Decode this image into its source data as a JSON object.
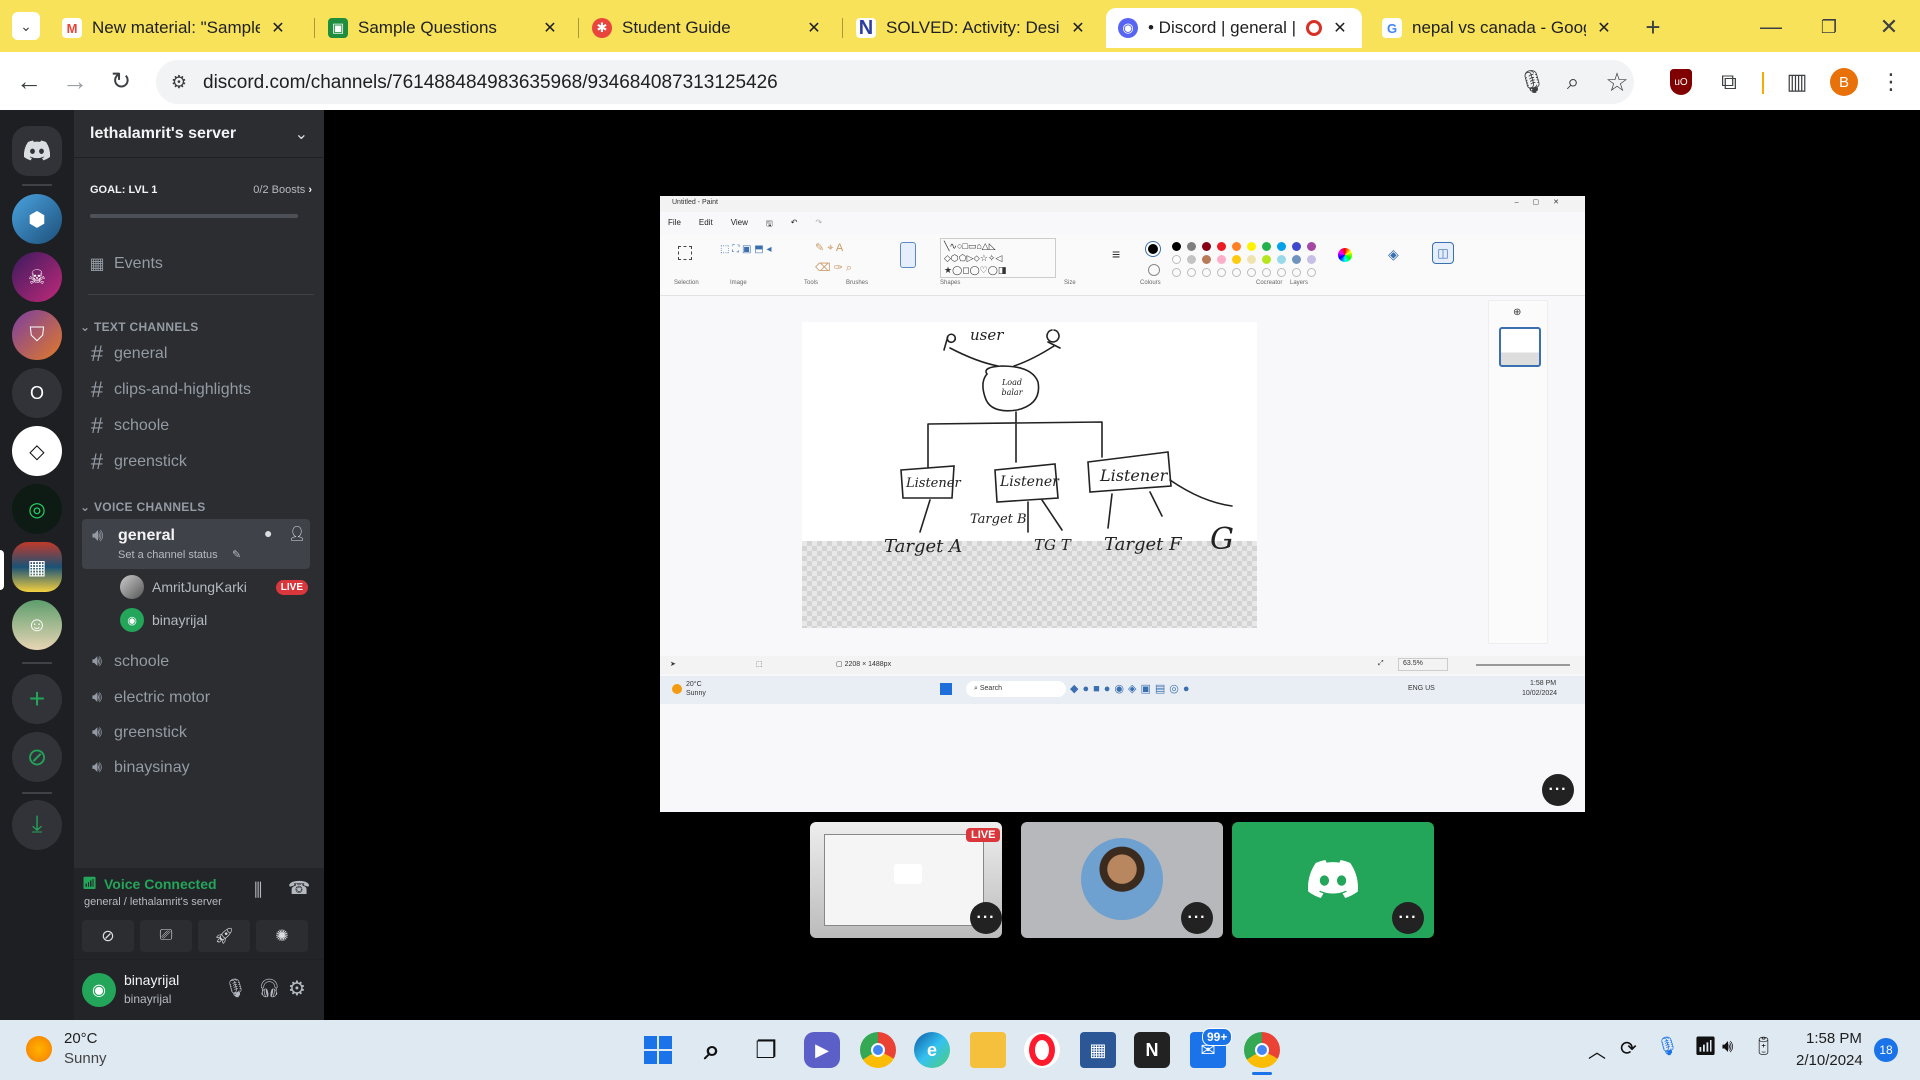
{
  "browser": {
    "tabs": [
      {
        "title": "New material: \"Sample Q",
        "icon": "gmail-icon",
        "color": "#ea4335",
        "glyph": "M"
      },
      {
        "title": "Sample Questions",
        "icon": "classroom-icon",
        "color": "#1e8e3e",
        "glyph": "▣"
      },
      {
        "title": "Student Guide",
        "icon": "guide-icon",
        "color": "#e8453c",
        "glyph": "✱"
      },
      {
        "title": "SOLVED: Activity: Design",
        "icon": "numerade-icon",
        "color": "#2c3e9f",
        "glyph": "N"
      },
      {
        "title": "• Discord | general | l",
        "icon": "discord-icon",
        "color": "#5865f2",
        "glyph": "◉",
        "active": true
      },
      {
        "title": "nepal vs canada - Google",
        "icon": "google-icon",
        "color": "#4285f4",
        "glyph": "G"
      }
    ],
    "url": "discord.com/channels/761488484983635968/934684087313125426",
    "profile_letter": "B"
  },
  "discord": {
    "server_name": "lethalamrit's server",
    "goal": {
      "label": "GOAL: LVL 1",
      "boosts": "0/2 Boosts"
    },
    "events_label": "Events",
    "text_category": "TEXT CHANNELS",
    "text_channels": [
      "general",
      "clips-and-highlights",
      "schoole",
      "greenstick"
    ],
    "voice_category": "VOICE CHANNELS",
    "active_voice": {
      "name": "general",
      "status": "Set a channel status"
    },
    "voice_users": [
      {
        "name": "AmritJungKarki",
        "badge": "LIVE"
      },
      {
        "name": "binayrijal",
        "badge": ""
      }
    ],
    "voice_channels": [
      "schoole",
      "electric motor",
      "greenstick",
      "binaysinay"
    ],
    "voice_connected": {
      "title": "Voice Connected",
      "sub": "general / lethalamrit's server"
    },
    "user": {
      "name": "binayrijal",
      "tag": "binayrijal"
    },
    "guild_o_label": "O",
    "thumb_live": "LIVE"
  },
  "paint": {
    "title": "Untitled - Paint",
    "menu": [
      "File",
      "Edit",
      "View"
    ],
    "groups": [
      "Selection",
      "Image",
      "Tools",
      "Brushes",
      "Shapes",
      "Size",
      "Colours",
      "Cocreator",
      "Layers"
    ],
    "canvas_size": "2208 × 1488px",
    "zoom": "63.5%",
    "drawing_text": {
      "top": "user",
      "center": "Load balar",
      "boxes": [
        "Listener",
        "Listener",
        "Listener"
      ],
      "targets": [
        "Target A",
        "Target B",
        "TG T",
        "Target F",
        "G"
      ]
    },
    "inner_taskbar": {
      "temp": "20°C",
      "weather": "Sunny",
      "search": "Search",
      "lang": "ENG US",
      "time": "1:58 PM",
      "date": "10/02/2024"
    }
  },
  "taskbar": {
    "temp": "20°C",
    "weather": "Sunny",
    "time": "1:58 PM",
    "date": "2/10/2024",
    "mail_badge": "99+",
    "notif_count": "18"
  },
  "colors": {
    "discord_dark": "#1e1f22",
    "discord_side": "#2b2d31",
    "green": "#23a55a",
    "live_red": "#da373c",
    "chrome_yellow": "#f7e25a"
  }
}
